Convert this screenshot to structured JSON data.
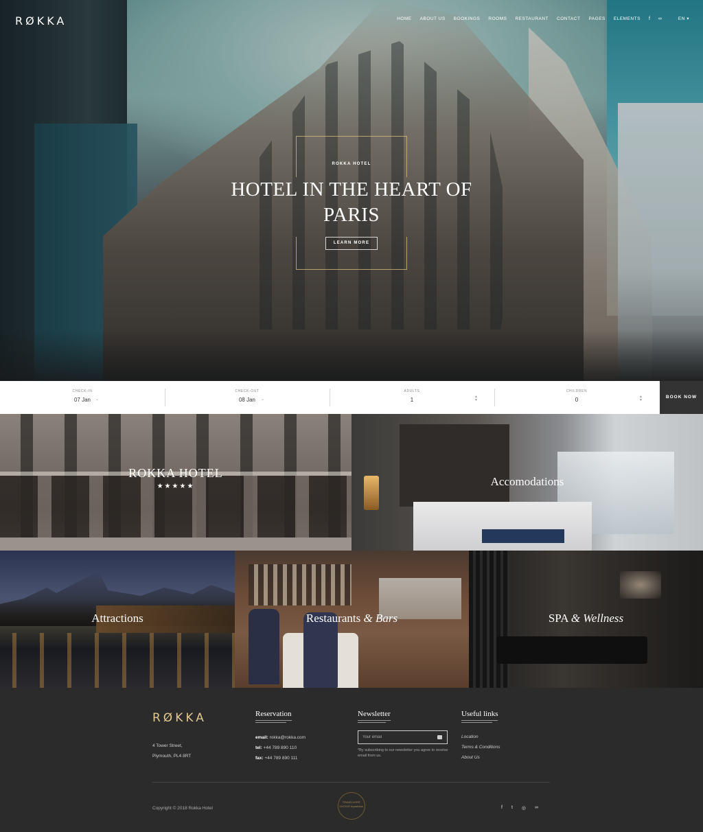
{
  "header": {
    "logo": "RØKKA",
    "nav": [
      "HOME",
      "ABOUT US",
      "BOOKINGS",
      "ROOMS",
      "RESTAURANT",
      "CONTACT",
      "PAGES",
      "ELEMENTS"
    ],
    "social_icons": [
      "facebook-icon",
      "tripadvisor-icon"
    ],
    "language": "EN ▾"
  },
  "hero": {
    "kicker": "ROKKA HOTEL",
    "title": "HOTEL IN THE HEART OF PARIS",
    "button": "LEARN MORE"
  },
  "booking": {
    "checkin_label": "CHECK-IN",
    "checkin_value": "07 Jan",
    "checkout_label": "CHECK-OUT",
    "checkout_value": "08 Jan",
    "adults_label": "ADULTS",
    "adults_value": "1",
    "children_label": "CHILDREN",
    "children_value": "0",
    "book_button": "BOOK NOW"
  },
  "tiles": {
    "hotel_title": "ROKKA HOTEL",
    "hotel_stars": "★★★★★",
    "accommodations": "Accomodations",
    "attractions": "Attractions",
    "restaurants_a": "Restaurants",
    "restaurants_amp": "&",
    "restaurants_b": "Bars",
    "spa_a": "SPA",
    "spa_amp": "&",
    "spa_b": "Wellness"
  },
  "footer": {
    "logo": "RØKKA",
    "address_line1": "4 Tower Street,",
    "address_line2": "Plymouth, PL4 8RT",
    "reservation_heading": "Reservation",
    "email_label": "email:",
    "email_value": "rokka@rokka.com",
    "tel_label": "tel:",
    "tel_value": "+44 789 890 110",
    "fax_label": "fax:",
    "fax_value": "+44 789 890 111",
    "newsletter_heading": "Newsletter",
    "newsletter_placeholder": "Your email",
    "newsletter_note": "*By subscribing to our newsletter you agree to receive email from us.",
    "links_heading": "Useful links",
    "links": [
      "Location",
      "Terms & Conditions",
      "About Us"
    ],
    "copyright": "Copyright © 2018 Rokka Hotel",
    "badge_text": "TRAVELLERS' CHOICE tripadvisor",
    "social": [
      "f",
      "t",
      "◎",
      "∞"
    ]
  }
}
